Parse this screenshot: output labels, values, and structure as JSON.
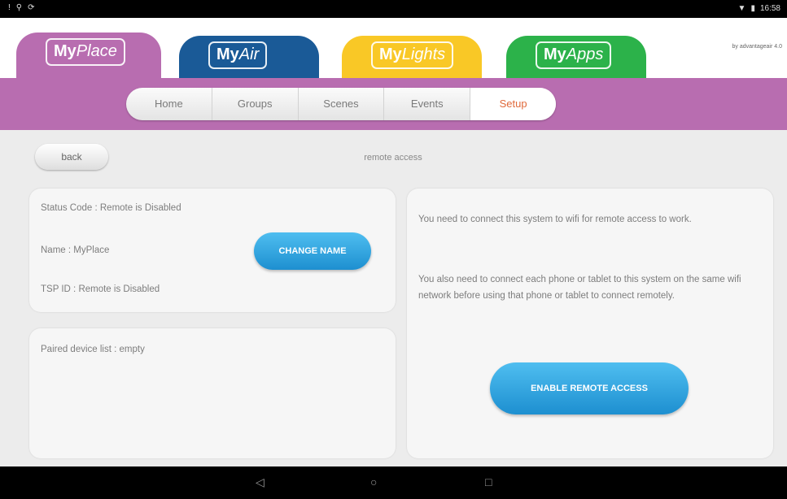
{
  "statusbar": {
    "left_icons": [
      "notification-icon",
      "usb-icon",
      "sync-icon"
    ],
    "time": "16:58",
    "right_icons": [
      "wifi-icon",
      "battery-icon"
    ]
  },
  "app_tabs": [
    {
      "my": "My",
      "name": "Place",
      "color": "#b86db0"
    },
    {
      "my": "My",
      "name": "Air",
      "color": "#1a5a97"
    },
    {
      "my": "My",
      "name": "Lights",
      "color": "#f9c826"
    },
    {
      "my": "My",
      "name": "Apps",
      "color": "#2cb24a"
    }
  ],
  "brand_text": "by advantageair 4.0",
  "nav": {
    "items": [
      "Home",
      "Groups",
      "Scenes",
      "Events",
      "Setup"
    ],
    "active": "Setup"
  },
  "page": {
    "back_label": "back",
    "title": "remote access"
  },
  "status_card": {
    "status_code": "Status Code : Remote is Disabled",
    "name": "Name : MyPlace",
    "tsp_id": "TSP ID : Remote is Disabled",
    "change_name_label": "CHANGE NAME"
  },
  "paired_card": {
    "text": "Paired device list : empty"
  },
  "info_card": {
    "para1": "You need to connect this system to wifi for remote access to work.",
    "para2": "You also need to connect each phone or tablet to this system on the same wifi network before using that phone or tablet to connect remotely.",
    "enable_label": "ENABLE REMOTE ACCESS"
  },
  "colors": {
    "accent_purple": "#b86db0",
    "button_blue": "#2a9fe0",
    "active_nav": "#e06a3b"
  },
  "android_nav": [
    "back-icon",
    "home-icon",
    "recents-icon"
  ]
}
